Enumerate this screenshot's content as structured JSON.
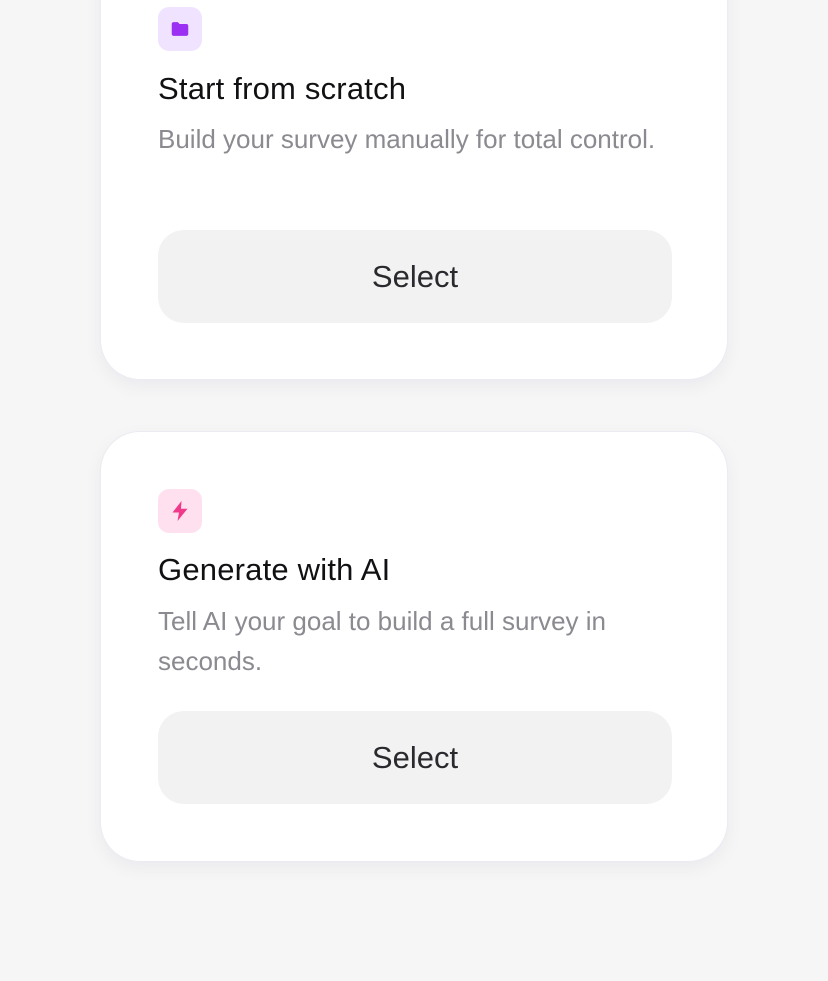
{
  "cards": [
    {
      "icon": "folder-icon",
      "icon_color": "#9b30f2",
      "icon_bg": "#f0e3ff",
      "title": "Start from scratch",
      "description": "Build your survey manually for total control.",
      "button_label": "Select"
    },
    {
      "icon": "lightning-bolt-icon",
      "icon_color": "#f0398a",
      "icon_bg": "#ffe0ef",
      "title": "Generate with AI",
      "description": "Tell AI your goal to build a full survey in seconds.",
      "button_label": "Select"
    }
  ]
}
